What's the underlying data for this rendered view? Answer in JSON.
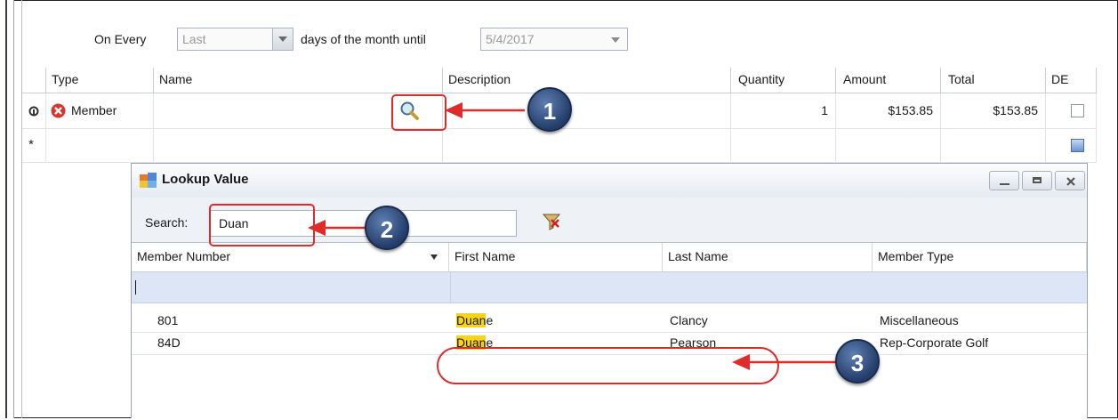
{
  "schedule": {
    "on_every_label": "On Every",
    "period_value": "Last",
    "days_label": "days of the month until",
    "until_value": "5/4/2017"
  },
  "grid": {
    "headers": [
      "Type",
      "Name",
      "Description",
      "Quantity",
      "Amount",
      "Total",
      "DE"
    ],
    "rows": [
      {
        "type": "Member",
        "name": "",
        "description": "",
        "quantity": "1",
        "amount": "$153.85",
        "total": "$153.85"
      }
    ],
    "new_row_marker": "*"
  },
  "lookup": {
    "title": "Lookup Value",
    "search_label": "Search:",
    "search_value": "Duan",
    "headers": [
      "Member Number",
      "First Name",
      "Last Name",
      "Member Type"
    ],
    "rows": [
      {
        "number": "801",
        "first_hl": "Duan",
        "first_rest": "e",
        "last": "Clancy",
        "type": "Miscellaneous"
      },
      {
        "number": "84D",
        "first_hl": "Duan",
        "first_rest": "e",
        "last": "Pearson",
        "type": "Rep-Corporate Golf"
      }
    ]
  },
  "annotations": {
    "step1": "1",
    "step2": "2",
    "step3": "3"
  },
  "colors": {
    "annotation_red": "#e02b2b",
    "badge_blue": "#2f4d80",
    "highlight": "#f7d417",
    "filter_row": "#dde6f6"
  }
}
